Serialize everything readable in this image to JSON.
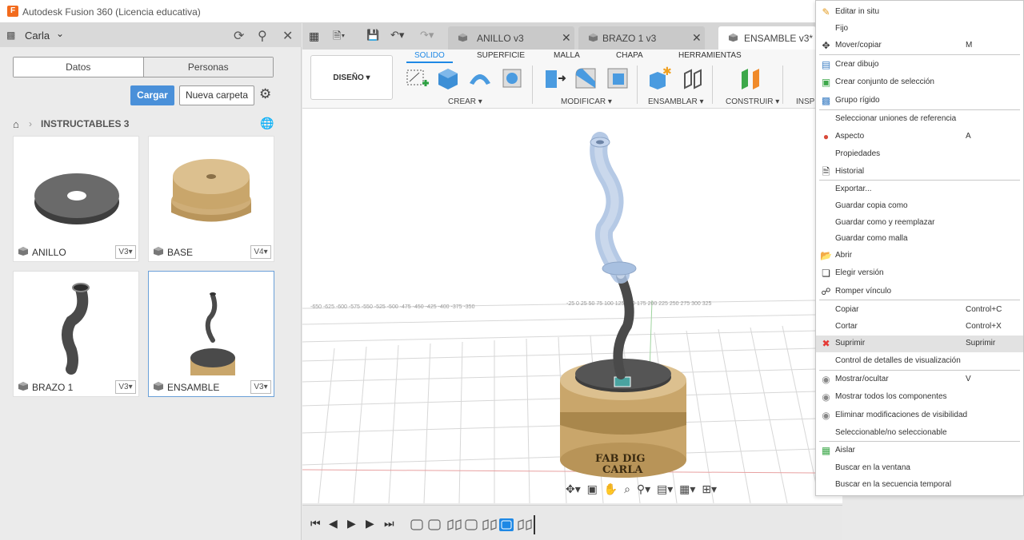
{
  "app": {
    "title": "Autodesk Fusion 360 (Licencia educativa)",
    "logo_letter": "F"
  },
  "data_panel": {
    "user": "Carla",
    "segments": [
      "Datos",
      "Personas"
    ],
    "upload_label": "Cargar",
    "new_folder_label": "Nueva carpeta",
    "breadcrumb_folder": "INSTRUCTABLES 3",
    "files": [
      {
        "name": "ANILLO",
        "version": "V3"
      },
      {
        "name": "BASE",
        "version": "V4"
      },
      {
        "name": "BRAZO 1",
        "version": "V3"
      },
      {
        "name": "ENSAMBLE",
        "version": "V3"
      }
    ]
  },
  "doc_tabs": [
    {
      "label": "ANILLO v3"
    },
    {
      "label": "BRAZO 1 v3"
    },
    {
      "label": "ENSAMBLE v3*"
    }
  ],
  "toolbar": {
    "workspace": "DISEÑO",
    "tabs": [
      "SOLIDO",
      "SUPERFICIE",
      "MALLA",
      "CHAPA",
      "HERRAMIENTAS"
    ],
    "groups": [
      "CREAR",
      "MODIFICAR",
      "ENSAMBLAR",
      "CONSTRUIR",
      "INSPE"
    ]
  },
  "model": {
    "engraving_line1": "FAB DIG",
    "engraving_line2": "CARLA"
  },
  "context_menu": {
    "items": [
      {
        "label": "Editar in situ",
        "shortcut": "",
        "icon": "pencil-icon"
      },
      {
        "label": "Fijo",
        "shortcut": "",
        "icon": ""
      },
      {
        "label": "Mover/copiar",
        "shortcut": "M",
        "icon": "move-icon"
      },
      {
        "label": "Crear dibujo",
        "shortcut": "",
        "icon": "drawing-icon"
      },
      {
        "label": "Crear conjunto de selección",
        "shortcut": "",
        "icon": "selection-set-icon"
      },
      {
        "label": "Grupo rígido",
        "shortcut": "",
        "icon": "rigid-group-icon"
      },
      {
        "label": "Seleccionar uniones de referencia",
        "shortcut": "",
        "icon": ""
      },
      {
        "label": "Aspecto",
        "shortcut": "A",
        "icon": "appearance-icon"
      },
      {
        "label": "Propiedades",
        "shortcut": "",
        "icon": ""
      },
      {
        "label": "Historial",
        "shortcut": "",
        "icon": "history-icon"
      },
      {
        "label": "Exportar...",
        "shortcut": "",
        "icon": ""
      },
      {
        "label": "Guardar copia como",
        "shortcut": "",
        "icon": ""
      },
      {
        "label": "Guardar como y reemplazar",
        "shortcut": "",
        "icon": ""
      },
      {
        "label": "Guardar como malla",
        "shortcut": "",
        "icon": ""
      },
      {
        "label": "Abrir",
        "shortcut": "",
        "icon": "folder-open-icon"
      },
      {
        "label": "Elegir versión",
        "shortcut": "",
        "icon": "versions-icon"
      },
      {
        "label": "Romper vínculo",
        "shortcut": "",
        "icon": "break-link-icon"
      },
      {
        "label": "Copiar",
        "shortcut": "Control+C",
        "icon": ""
      },
      {
        "label": "Cortar",
        "shortcut": "Control+X",
        "icon": ""
      },
      {
        "label": "Suprimir",
        "shortcut": "Suprimir",
        "icon": "delete-icon"
      },
      {
        "label": "Control de detalles de visualización",
        "shortcut": "",
        "icon": ""
      },
      {
        "label": "Mostrar/ocultar",
        "shortcut": "V",
        "icon": "eye-icon"
      },
      {
        "label": "Mostrar todos los componentes",
        "shortcut": "",
        "icon": "eye-icon"
      },
      {
        "label": "Eliminar modificaciones de visibilidad",
        "shortcut": "",
        "icon": "eye-icon"
      },
      {
        "label": "Seleccionable/no seleccionable",
        "shortcut": "",
        "icon": ""
      },
      {
        "label": "Aislar",
        "shortcut": "",
        "icon": "isolate-icon"
      },
      {
        "label": "Buscar en la ventana",
        "shortcut": "",
        "icon": ""
      },
      {
        "label": "Buscar en la secuencia temporal",
        "shortcut": "",
        "icon": ""
      }
    ]
  },
  "colors": {
    "accent": "#1e88e5",
    "upload": "#4a90d9",
    "delete": "#e53935",
    "base": "#c9a66b"
  }
}
